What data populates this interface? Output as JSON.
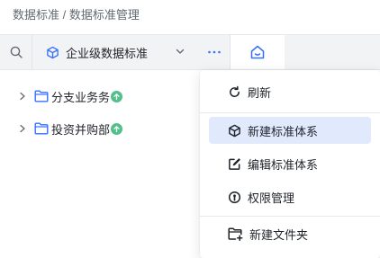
{
  "breadcrumb": "数据标准 / 数据标准管理",
  "toolbar": {
    "search_icon": "search-icon",
    "select_value": "企业级数据标准",
    "more_icon": "ellipsis-icon",
    "home_icon": "home-icon"
  },
  "tree": {
    "items": [
      {
        "label": "分支业务务"
      },
      {
        "label": "投资并购部"
      }
    ]
  },
  "menu": {
    "items": [
      {
        "label": "刷新",
        "icon": "refresh-icon"
      },
      {
        "label": "新建标准体系",
        "icon": "cube-icon"
      },
      {
        "label": "编辑标准体系",
        "icon": "edit-icon"
      },
      {
        "label": "权限管理",
        "icon": "permission-icon"
      },
      {
        "label": "新建文件夹",
        "icon": "new-folder-icon"
      }
    ]
  },
  "colors": {
    "accent": "#3370ff",
    "badge": "#52c08b",
    "menu_active": "#e1e9fd"
  }
}
